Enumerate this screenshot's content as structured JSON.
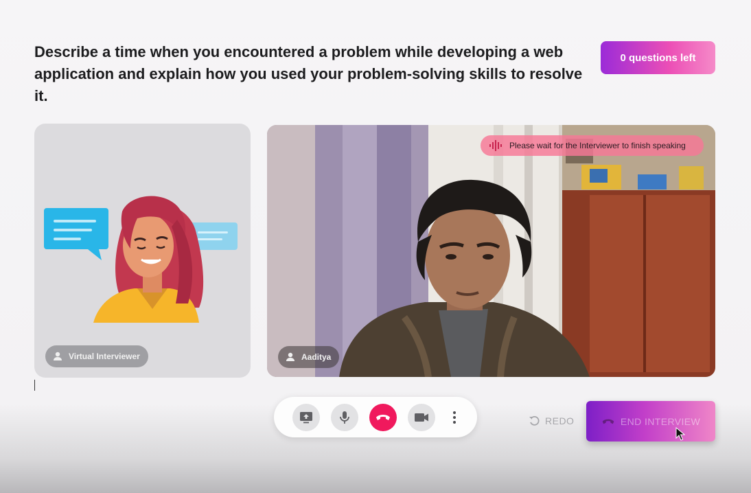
{
  "question": {
    "text": "Describe a time when you encountered a problem while developing a web application and explain how you used your problem-solving skills to resolve it."
  },
  "questions_left": {
    "label": "0 questions left"
  },
  "virtual_interviewer": {
    "name": "Virtual Interviewer",
    "icon": "person-icon"
  },
  "candidate": {
    "name": "Aaditya",
    "icon": "person-icon",
    "status_banner": "Please wait for the Interviewer to finish speaking"
  },
  "controls": {
    "share_screen_icon": "screen-share-icon",
    "mic_icon": "microphone-icon",
    "hangup_icon": "phone-hangup-icon",
    "camera_icon": "video-camera-icon",
    "more_icon": "more-vertical-icon"
  },
  "redo": {
    "label": "REDO",
    "icon": "undo-icon"
  },
  "end_interview": {
    "label": "END INTERVIEW",
    "icon": "phone-hangup-icon"
  },
  "colors": {
    "accent_purple": "#9b2bd8",
    "accent_pink": "#ec4fb6",
    "hangup_red": "#f0195d"
  }
}
